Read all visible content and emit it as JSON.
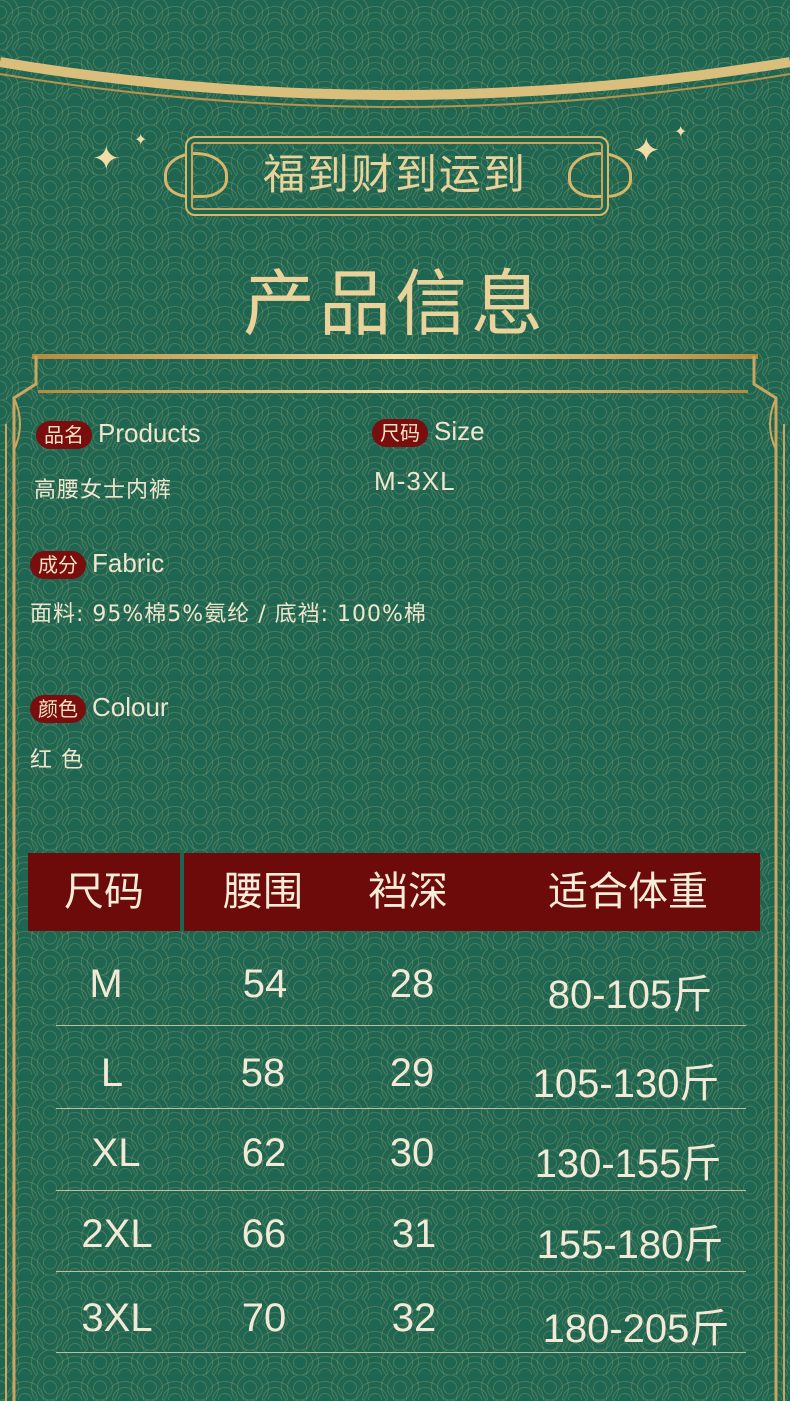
{
  "banner": {
    "slogan": "福到财到运到"
  },
  "title": "产品信息",
  "info": {
    "product": {
      "tag": "品名",
      "label": "Products",
      "value": "高腰女士内裤"
    },
    "size": {
      "tag": "尺码",
      "label": "Size",
      "value": "M-3XL"
    },
    "fabric": {
      "tag": "成分",
      "label": "Fabric",
      "value": "面料: 95%棉5%氨纶 / 底裆: 100%棉"
    },
    "colour": {
      "tag": "颜色",
      "label": "Colour",
      "value": "红 色"
    }
  },
  "table": {
    "headers": [
      "尺码",
      "腰围",
      "裆深",
      "适合体重"
    ],
    "rows": [
      [
        "M",
        "54",
        "28",
        "80-105斤"
      ],
      [
        "L",
        "58",
        "29",
        "105-130斤"
      ],
      [
        "XL",
        "62",
        "30",
        "130-155斤"
      ],
      [
        "2XL",
        "66",
        "31",
        "155-180斤"
      ],
      [
        "3XL",
        "70",
        "32",
        "180-205斤"
      ]
    ]
  },
  "colors": {
    "background": "#1f6652",
    "gold": "#d8b769",
    "header_red": "#6d0a0a",
    "tag_red": "#7a0d0e"
  }
}
